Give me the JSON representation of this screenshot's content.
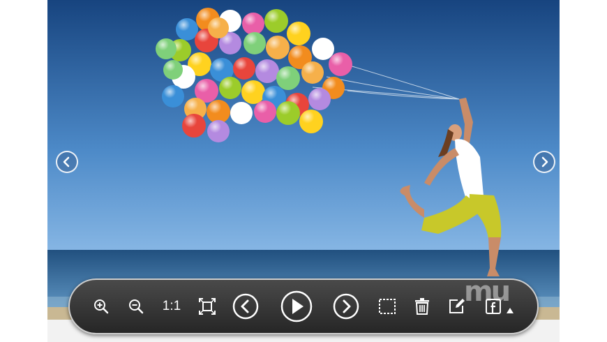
{
  "toolbar": {
    "zoom_in": "zoom-in-icon",
    "zoom_out": "zoom-out-icon",
    "actual_size_label": "1:1",
    "fit": "fit-screen-icon",
    "previous": "previous-icon",
    "play": "play-icon",
    "next": "next-icon",
    "select": "selection-icon",
    "delete": "trash-icon",
    "edit": "edit-icon",
    "share": "facebook-icon"
  },
  "watermark": "mu",
  "colors": {
    "sky_top": "#1a4a8c",
    "sky_bottom": "#6aa3dc",
    "sea": "#2b5e8e",
    "toolbar": "#333333",
    "pants": "#c8c82a"
  }
}
